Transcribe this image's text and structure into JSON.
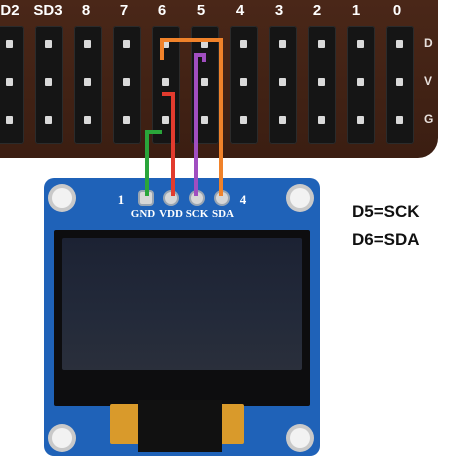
{
  "header": {
    "pin_labels": [
      "D2",
      "SD3",
      "8",
      "7",
      "6",
      "5",
      "4",
      "3",
      "2",
      "1",
      "0"
    ],
    "row_labels": [
      "D",
      "V",
      "G"
    ]
  },
  "module": {
    "pin_number_left": "1",
    "pin_number_right": "4",
    "pins": [
      "GND",
      "VDD",
      "SCK",
      "SDA"
    ]
  },
  "notes": [
    "D5=SCK",
    "D6=SDA"
  ],
  "colors": {
    "board": "#4a2718",
    "pcb": "#1f62b8",
    "wire_gnd": "#2aa53a",
    "wire_vdd": "#e23b2e",
    "wire_sck": "#a04ec0",
    "wire_sda": "#f0822a"
  }
}
